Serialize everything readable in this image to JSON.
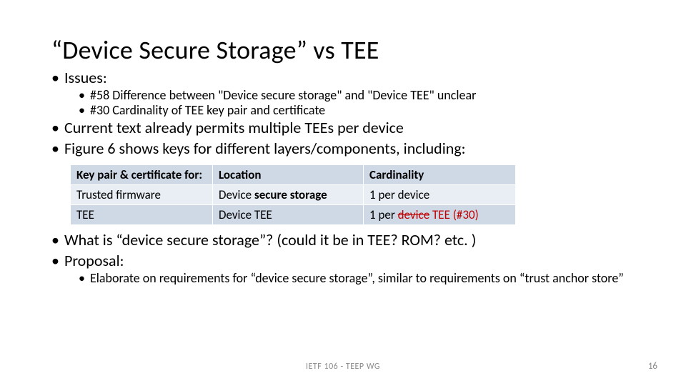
{
  "title": "“Device Secure Storage” vs TEE",
  "bullets": {
    "issues_label": "Issues:",
    "issue1": "#58 Difference between \"Device secure storage\" and \"Device TEE\" unclear",
    "issue2": "#30 Cardinality of TEE key pair and certificate",
    "current_text": "Current text already permits multiple TEEs per device",
    "figure6": "Figure 6 shows keys for different layers/components, including:",
    "what_is": "What is “device secure storage”? (could it be in TEE?  ROM? etc. )",
    "proposal_label": "Proposal:",
    "proposal1": "Elaborate on requirements for “device secure storage”, similar to requirements on “trust anchor store”"
  },
  "table": {
    "headers": {
      "c0": "Key pair & certificate for:",
      "c1": "Location",
      "c2": "Cardinality"
    },
    "r1": {
      "c0": "Trusted firmware",
      "c1_pre": "Device ",
      "c1_bold": "secure storage",
      "c2": "1 per device"
    },
    "r2": {
      "c0": "TEE",
      "c1": "Device TEE",
      "c2_pre": "1 per ",
      "c2_strike": "device",
      "c2_ins": " TEE (#30)"
    }
  },
  "footer": {
    "center": "IETF 106 - TEEP WG",
    "page": "16"
  }
}
